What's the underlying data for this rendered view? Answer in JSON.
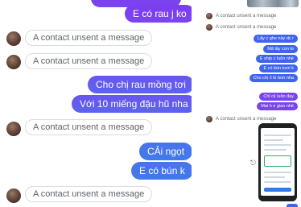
{
  "main_conversation": {
    "outgoing": [
      {
        "text": "",
        "tone": "top"
      },
      {
        "text": "E có rau j ko",
        "tone": "top"
      },
      {
        "text": "Cho chị rau mồng tơi",
        "tone": "mid"
      },
      {
        "text": "Với 10 miếng đậu hũ nha",
        "tone": "mid"
      },
      {
        "text": "CẢi ngọt",
        "tone": "low"
      },
      {
        "text": "E có bún k",
        "tone": "low"
      }
    ],
    "unsent_notice": "A contact unsent a message"
  },
  "side_conversation": {
    "unsent_notice": "A contact unsent a message",
    "outgoing": [
      {
        "text": "Lấy c ghe này dc r",
        "tone": "blue"
      },
      {
        "text": "Mã lấy con to",
        "tone": "blue"
      },
      {
        "text": "E ship c luôn nhé",
        "tone": "blue"
      },
      {
        "text": "E có bún tươi k",
        "tone": "blue"
      },
      {
        "text": "Cho chị 2 kí bún nha",
        "tone": "blue"
      },
      {
        "text": "Chỉ ck luôn đay",
        "tone": "purple"
      },
      {
        "text": "Mai h e giao nhé",
        "tone": "purple"
      }
    ]
  },
  "colors": {
    "bubble_purple": "#7d3cf2",
    "bubble_indigo": "#5c63ee",
    "bubble_blue": "#3f7bea",
    "unsent_border": "#d9dbe0",
    "unsent_text": "#5f6368"
  },
  "icons": [
    "avatar",
    "share-icon"
  ]
}
